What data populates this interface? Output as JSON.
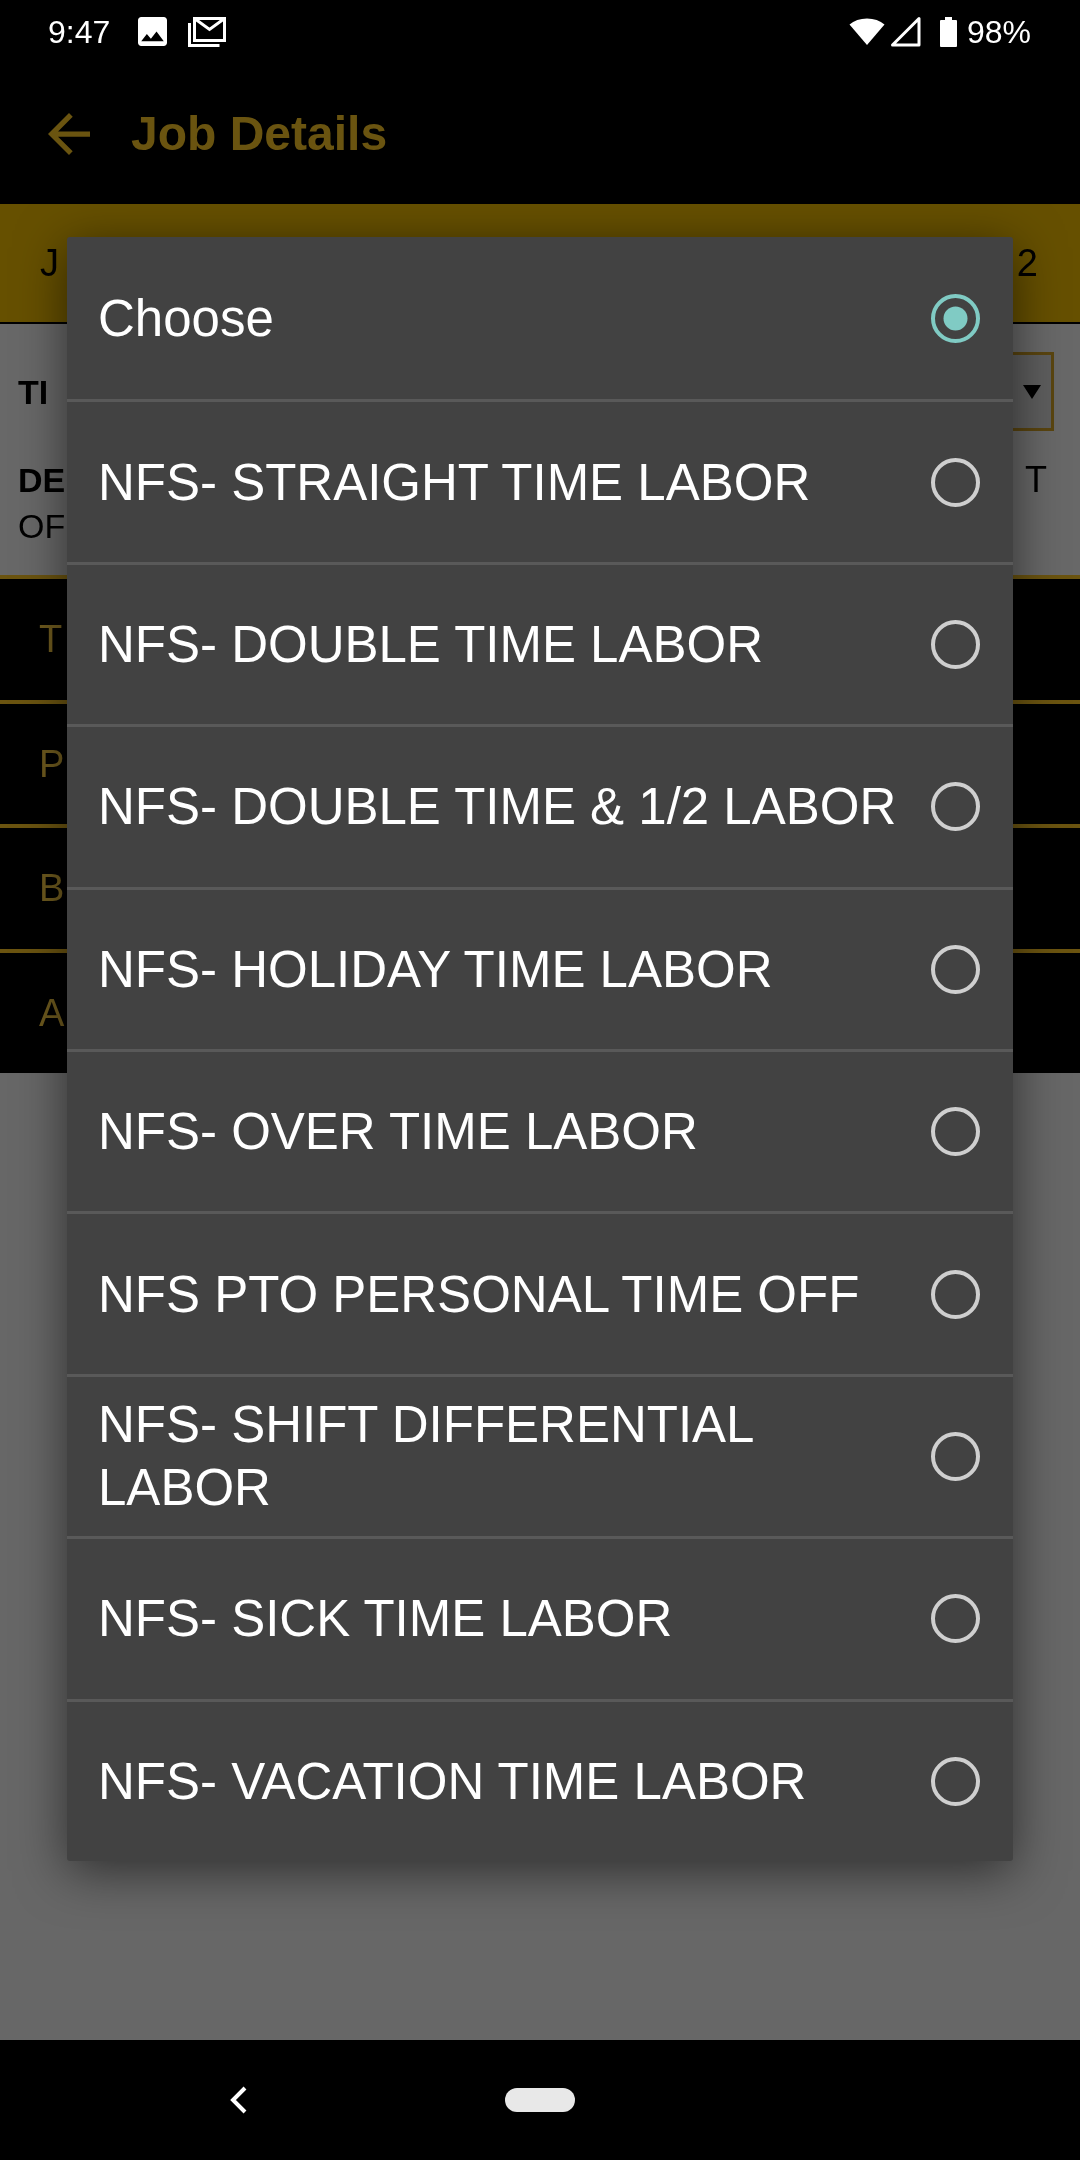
{
  "status_bar": {
    "time": "9:47",
    "battery": "98%"
  },
  "app_bar": {
    "title": "Job Details"
  },
  "job_banner": {
    "column_1": "J",
    "column_2": "2"
  },
  "details": {
    "field_label": "TI",
    "description_label": "DE",
    "description_line_1_end": "T",
    "description_line_2": "OF"
  },
  "sections": [
    {
      "label": "T"
    },
    {
      "label": "P"
    },
    {
      "label": "B"
    },
    {
      "label": "A"
    }
  ],
  "dialog": {
    "options": [
      {
        "label": "Choose",
        "selected": true
      },
      {
        "label": "NFS- STRAIGHT TIME LABOR",
        "selected": false
      },
      {
        "label": "NFS- DOUBLE TIME LABOR",
        "selected": false
      },
      {
        "label": "NFS- DOUBLE TIME & 1/2 LABOR",
        "selected": false
      },
      {
        "label": "NFS- HOLIDAY TIME LABOR",
        "selected": false
      },
      {
        "label": "NFS- OVER TIME LABOR",
        "selected": false
      },
      {
        "label": "NFS PTO PERSONAL TIME OFF",
        "selected": false
      },
      {
        "label": "NFS- SHIFT DIFFERENTIAL LABOR",
        "selected": false
      },
      {
        "label": "NFS- SICK TIME LABOR",
        "selected": false
      },
      {
        "label": "NFS- VACATION TIME LABOR",
        "selected": false
      }
    ]
  }
}
